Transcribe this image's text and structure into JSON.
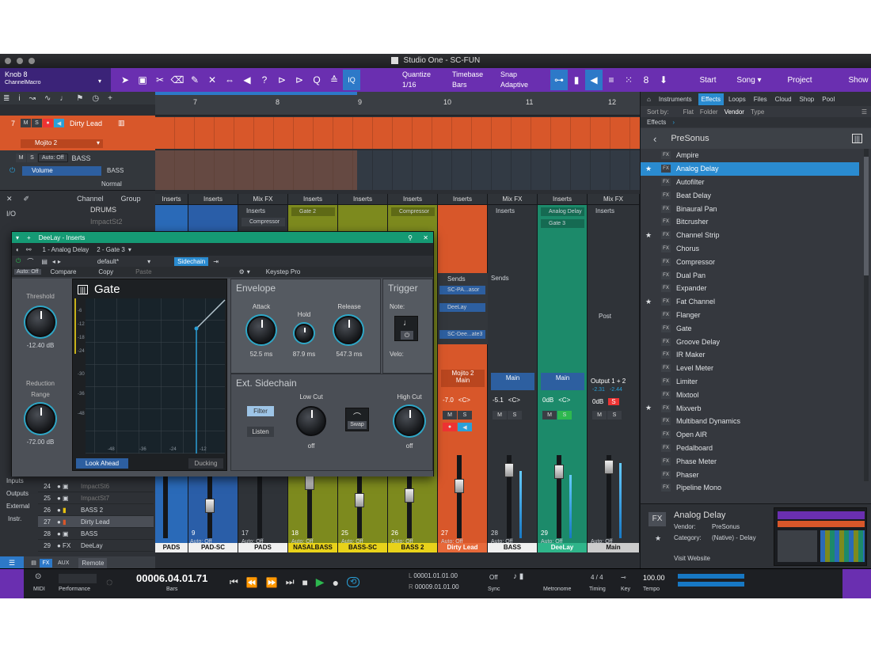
{
  "window": {
    "title": "Studio One - SC-FUN"
  },
  "toolbar": {
    "knob_label": "Knob 8",
    "knob_sub": "ChannelMacro",
    "quantize_label": "Quantize",
    "quantize_value": "1/16",
    "timebase_label": "Timebase",
    "timebase_value": "Bars",
    "snap_label": "Snap",
    "snap_value": "Adaptive",
    "iq": "IQ",
    "nav": [
      "Start",
      "Song",
      "Project",
      "Show"
    ]
  },
  "ruler": {
    "bars": [
      "7",
      "8",
      "9",
      "10",
      "11",
      "12"
    ]
  },
  "tracks": {
    "track1": {
      "num": "7",
      "name": "Dirty Lead",
      "instrument": "Mojito 2"
    },
    "track2": {
      "auto": "Auto: Off",
      "name": "BASS",
      "param": "Volume",
      "param_track": "BASS",
      "mode": "Normal"
    }
  },
  "console_list": {
    "header_channel": "Channel",
    "header_group": "Group",
    "io": "I/O",
    "top_rows": [
      {
        "name": "DRUMS"
      },
      {
        "name": "ImpactSt2"
      }
    ],
    "side_labels": [
      "Inputs",
      "Outputs",
      "External",
      "Instr."
    ],
    "rows": [
      {
        "num": "24",
        "name": "ImpactSt6"
      },
      {
        "num": "25",
        "name": "ImpactSt7"
      },
      {
        "num": "26",
        "name": "BASS 2"
      },
      {
        "num": "27",
        "name": "Dirty Lead"
      },
      {
        "num": "28",
        "name": "BASS"
      },
      {
        "num": "29",
        "name": "DeeLay"
      }
    ],
    "fx": "FX",
    "aux": "AUX",
    "remote": "Remote"
  },
  "mixer": {
    "inserts": "Inserts",
    "mixfx": "Mix FX",
    "sends": "Sends",
    "post": "Post",
    "gate2": "Gate 2",
    "compressor": "Compressor",
    "analog_delay": "Analog Delay",
    "gate3": "Gate 3",
    "send1": "SC-PA...asor",
    "send2": "DeeLay",
    "send3": "SC-Dee...ate3",
    "mojito_main": "Mojito 2",
    "main": "Main",
    "output": "Output 1 + 2",
    "vol_lead": "-7.0",
    "vol_bass": "-5.1",
    "vol_deelay": "0dB",
    "vol_main": "0dB",
    "pan": "<C>",
    "peak_l": "-2.31",
    "peak_r": "-2.44",
    "auto_off": "Auto: Off",
    "channels": [
      {
        "num": "",
        "name": "PADS"
      },
      {
        "num": "9",
        "name": "PAD-SC"
      },
      {
        "num": "17",
        "name": "PADS"
      },
      {
        "num": "18",
        "name": "NASALBASS"
      },
      {
        "num": "25",
        "name": "BASS-SC"
      },
      {
        "num": "26",
        "name": "BASS 2"
      },
      {
        "num": "27",
        "name": "Dirty Lead"
      },
      {
        "num": "28",
        "name": "BASS"
      },
      {
        "num": "29",
        "name": "DeeLay"
      },
      {
        "num": "",
        "name": "Main"
      }
    ]
  },
  "plugin": {
    "title": "DeeLay - Inserts",
    "slot1": "1 - Analog Delay",
    "slot2": "2 - Gate 3",
    "preset": "default*",
    "sidechain": "Sidechain",
    "auto": "Auto: Off",
    "compare": "Compare",
    "copy": "Copy",
    "paste": "Paste",
    "keystep": "Keystep Pro",
    "name": "Gate",
    "threshold_label": "Threshold",
    "threshold_value": "-12.40 dB",
    "reduction_label": "Reduction",
    "range_label": "Range",
    "range_value": "-72.00 dB",
    "y_ticks": [
      "-6",
      "-12",
      "-18",
      "-24",
      "-30",
      "-36",
      "-48"
    ],
    "x_ticks": [
      "-48",
      "-36",
      "-24",
      "-12"
    ],
    "look_ahead": "Look Ahead",
    "ducking": "Ducking",
    "envelope": "Envelope",
    "attack_label": "Attack",
    "attack_value": "52.5 ms",
    "hold_label": "Hold",
    "hold_value": "87.9 ms",
    "release_label": "Release",
    "release_value": "547.3 ms",
    "trigger": "Trigger",
    "note_label": "Note:",
    "velo_label": "Velo:",
    "ext_sidechain": "Ext. Sidechain",
    "filter": "Filter",
    "listen": "Listen",
    "low_cut_label": "Low Cut",
    "low_cut_value": "off",
    "swap": "Swap",
    "high_cut_label": "High Cut",
    "high_cut_value": "off"
  },
  "browser": {
    "tabs": [
      "Instruments",
      "Effects",
      "Loops",
      "Files",
      "Cloud",
      "Shop",
      "Pool"
    ],
    "sort_label": "Sort by:",
    "sort_options": [
      "Flat",
      "Folder",
      "Vendor",
      "Type"
    ],
    "crumb": "Effects",
    "vendor": "PreSonus",
    "items": [
      "Ampire",
      "Analog Delay",
      "Autofilter",
      "Beat Delay",
      "Binaural Pan",
      "Bitcrusher",
      "Channel Strip",
      "Chorus",
      "Compressor",
      "Dual Pan",
      "Expander",
      "Fat Channel",
      "Flanger",
      "Gate",
      "Groove Delay",
      "IR Maker",
      "Level Meter",
      "Limiter",
      "Mixtool",
      "Mixverb",
      "Multiband Dynamics",
      "Open AIR",
      "Pedalboard",
      "Phase Meter",
      "Phaser",
      "Pipeline Mono"
    ],
    "info_name": "Analog Delay",
    "info_vendor_label": "Vendor:",
    "info_vendor": "PreSonus",
    "info_category_label": "Category:",
    "info_category": "(Native) - Delay",
    "visit": "Visit Website"
  },
  "transport": {
    "midi": "MIDI",
    "performance": "Performance",
    "position": "00006.04.01.71",
    "position_unit": "Bars",
    "loop_l": "00001.01.01.00",
    "loop_r": "00009.01.01.00",
    "sync_value": "Off",
    "sync_label": "Sync",
    "metronome": "Metronome",
    "timing_value": "4 / 4",
    "timing_label": "Timing",
    "key_label": "Key",
    "tempo_value": "100.00",
    "tempo_label": "Tempo"
  }
}
